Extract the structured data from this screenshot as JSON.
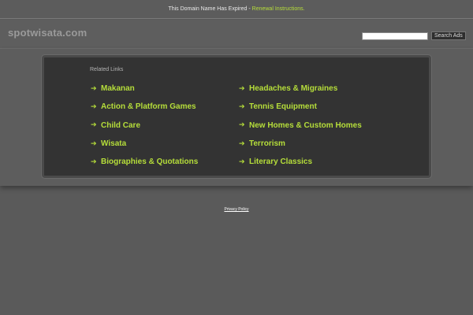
{
  "topbar": {
    "expired_text": "This Domain Name Has Expired - ",
    "renewal_link": "Renewal Instructions."
  },
  "header": {
    "site_name": "spotwisata.com",
    "search": {
      "value": "",
      "button_label": "Search Ads"
    }
  },
  "related": {
    "heading": "Related Links",
    "left": [
      "Makanan",
      "Action & Platform Games",
      "Child Care",
      "Wisata",
      "Biographies & Quotations"
    ],
    "right": [
      "Headaches & Migraines",
      "Tennis Equipment",
      "New Homes & Custom Homes",
      "Terrorism",
      "Literary Classics"
    ]
  },
  "footer": {
    "privacy_label": "Privacy Policy"
  },
  "colors": {
    "accent": "#b6de3a",
    "background": "#5a5a5a",
    "panel": "#333333"
  },
  "icons": {
    "link_arrow": "arrow-right-icon"
  }
}
